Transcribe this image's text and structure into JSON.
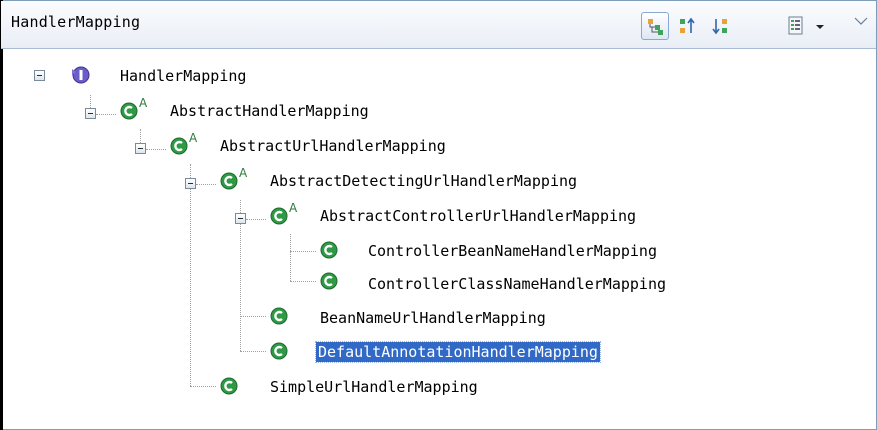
{
  "view": {
    "title": "HandlerMapping"
  },
  "toolbar": {
    "icons": [
      "type-hierarchy-icon",
      "supertype-hierarchy-icon",
      "subtype-hierarchy-icon",
      "layout-icon",
      "dropdown-arrow-icon",
      "view-menu-icon"
    ]
  },
  "colors": {
    "selection": "#3169c6",
    "class_icon": "#2e9a45",
    "interface_icon": "#6b5fc7"
  },
  "tree": {
    "nodes": [
      {
        "label": "HandlerMapping",
        "kind": "interface"
      },
      {
        "label": "AbstractHandlerMapping",
        "kind": "abstract-class"
      },
      {
        "label": "AbstractUrlHandlerMapping",
        "kind": "abstract-class"
      },
      {
        "label": "AbstractDetectingUrlHandlerMapping",
        "kind": "abstract-class"
      },
      {
        "label": "AbstractControllerUrlHandlerMapping",
        "kind": "abstract-class"
      },
      {
        "label": "ControllerBeanNameHandlerMapping",
        "kind": "class"
      },
      {
        "label": "ControllerClassNameHandlerMapping",
        "kind": "class"
      },
      {
        "label": "BeanNameUrlHandlerMapping",
        "kind": "class"
      },
      {
        "label": "DefaultAnnotationHandlerMapping",
        "kind": "class",
        "selected": true
      },
      {
        "label": "SimpleUrlHandlerMapping",
        "kind": "class"
      }
    ]
  }
}
